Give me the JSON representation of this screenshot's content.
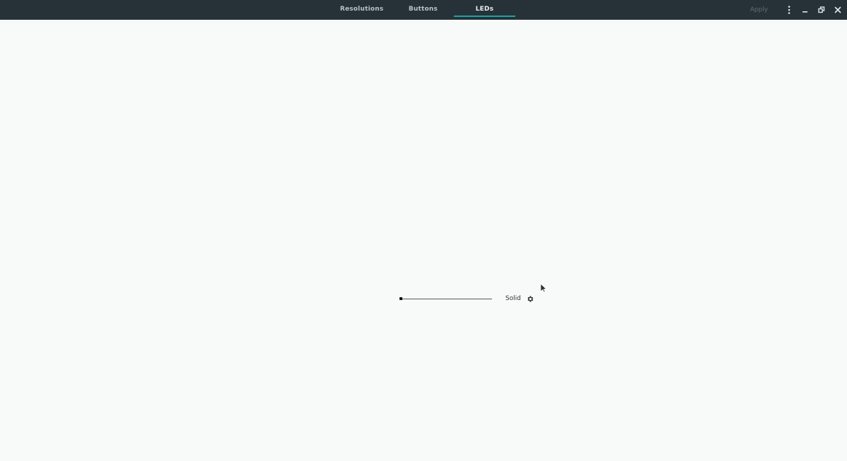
{
  "tabs": [
    {
      "label": "Resolutions"
    },
    {
      "label": "Buttons"
    },
    {
      "label": "LEDs"
    }
  ],
  "active_tab": "LEDs",
  "header": {
    "apply_label": "Apply",
    "menu_icon": "kebab-menu-icon",
    "minimize_icon": "minimize-icon",
    "restore_icon": "restore-icon",
    "close_icon": "close-icon"
  },
  "led": {
    "brightness": 0.0,
    "mode_label": "Solid",
    "settings_icon": "gear-icon"
  },
  "colors": {
    "header_bg": "#263238",
    "accent": "#1fa3a3",
    "page_bg": "#f8fafa"
  }
}
